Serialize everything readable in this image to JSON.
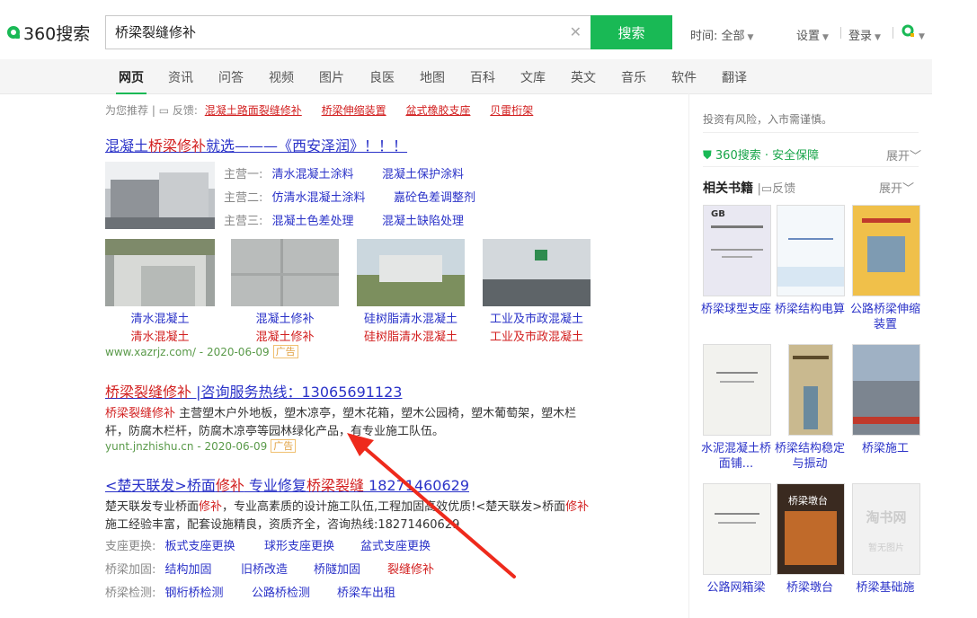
{
  "header": {
    "logo_text": "360搜索",
    "search_value": "桥梁裂缝修补",
    "search_button": "搜索",
    "time_label": "时间:",
    "time_value": "全部",
    "settings": "设置",
    "login": "登录"
  },
  "nav": {
    "tabs": [
      "网页",
      "资讯",
      "问答",
      "视频",
      "图片",
      "良医",
      "地图",
      "百科",
      "文库",
      "英文",
      "音乐",
      "软件",
      "翻译"
    ]
  },
  "recommend": {
    "prefix": "为您推荐",
    "feedback": "反馈:",
    "links": [
      "混凝土路面裂缝修补",
      "桥梁伸缩装置",
      "盆式橡胶支座",
      "贝雷桁架"
    ]
  },
  "result1": {
    "title_parts": [
      "混凝土",
      "桥梁修补",
      "就选———《西安泽润》！！！"
    ],
    "rows": [
      {
        "label": "主营一:",
        "a": "清水混凝土涂料",
        "b": "混凝土保护涂料"
      },
      {
        "label": "主营二:",
        "a": "仿清水混凝土涂料",
        "b": "嘉砼色差调整剂"
      },
      {
        "label": "主营三:",
        "a": "混凝土色差处理",
        "b": "混凝土缺陷处理"
      }
    ],
    "gallery": [
      {
        "cap1": "清水混凝土",
        "cap2": "清水混凝土"
      },
      {
        "cap1": "混凝土修补",
        "cap2": "混凝土修补"
      },
      {
        "cap1": "硅树脂清水混凝土",
        "cap2": "硅树脂清水混凝土"
      },
      {
        "cap1": "工业及市政混凝土",
        "cap2": "工业及市政混凝土"
      }
    ],
    "url": "www.xazrjz.com/",
    "date": "2020-06-09",
    "ad": "广告"
  },
  "result2": {
    "title_red": "桥梁裂缝修补",
    "title_rest": " |咨询服务热线：13065691123",
    "desc_red": "桥梁裂缝修补",
    "desc1": " 主营塑木户外地板，塑木凉亭，塑木花箱，塑木公园椅，塑木葡萄架，塑木栏",
    "desc2": "杆，防腐木栏杆，防腐木凉亭等园林绿化产品，有专业施工队伍。",
    "url": "yunt.jnzhishu.cn",
    "date": "2020-06-09",
    "ad": "广告"
  },
  "result3": {
    "title_a": "<楚天联发>桥面",
    "title_b": "修补",
    "title_c": " 专业修复",
    "title_d": "桥梁裂缝",
    "title_e": " 18271460629",
    "desc1a": "楚天联发专业桥面",
    "desc1b": "修补",
    "desc1c": "，专业高素质的设计施工队伍,工程加固高效优质!<楚天联发>桥面",
    "desc1d": "修补",
    "desc2": "施工经验丰富，配套设施精良，资质齐全，咨询热线:18271460629",
    "sublinks": [
      {
        "label": "支座更换:",
        "items": [
          "板式支座更换",
          "球形支座更换",
          "盆式支座更换"
        ]
      },
      {
        "label": "桥梁加固:",
        "items": [
          "结构加固",
          "旧桥改造",
          "桥隧加固",
          "裂缝修补"
        ]
      },
      {
        "label": "桥梁检测:",
        "items": [
          "钢桁桥检测",
          "公路桥检测",
          "桥梁车出租"
        ]
      }
    ]
  },
  "right": {
    "risk": "投资有风险，入市需谨慎。",
    "safe": "360搜索 · 安全保障",
    "expand1": "展开",
    "books_title": "相关书籍",
    "books_feedback": "反馈",
    "expand2": "展开",
    "books": [
      {
        "title": "桥梁球型支座"
      },
      {
        "title": "桥梁结构电算"
      },
      {
        "title": "公路桥梁伸缩装置"
      },
      {
        "title": "水泥混凝土桥面铺..."
      },
      {
        "title": "桥梁结构稳定与振动"
      },
      {
        "title": "桥梁施工"
      },
      {
        "title": "公路网箱梁"
      },
      {
        "title": "桥梁墩台"
      },
      {
        "title": "桥梁基础施"
      }
    ],
    "book_texts": {
      "b1": "GB",
      "b8": "桥梁墩台",
      "b9": "淘书网",
      "b9b": "暂无图片"
    }
  }
}
